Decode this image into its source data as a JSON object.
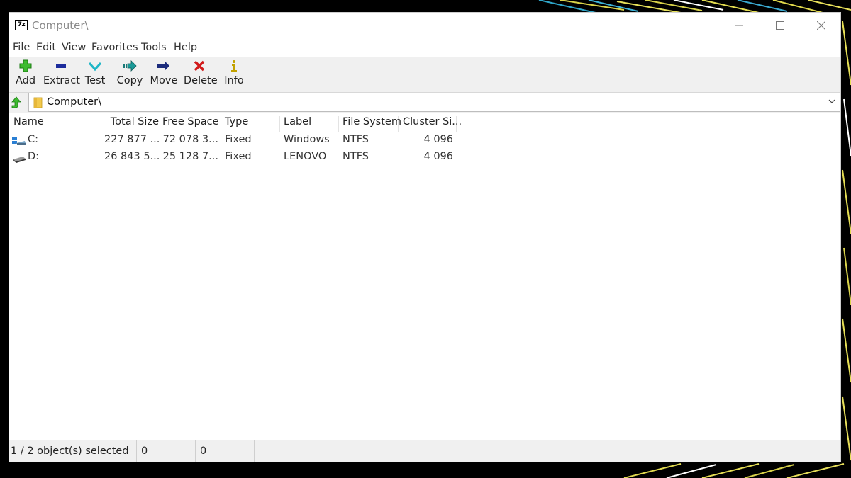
{
  "window": {
    "title": "Computer\\",
    "app_icon_text": "7z"
  },
  "menu": [
    "File",
    "Edit",
    "View",
    "Favorites",
    "Tools",
    "Help"
  ],
  "toolbar": [
    {
      "label": "Add",
      "icon": "add-icon",
      "color": "#22a822"
    },
    {
      "label": "Extract",
      "icon": "extract-icon",
      "color": "#1c2c9c"
    },
    {
      "label": "Test",
      "icon": "test-icon",
      "color": "#1fb6c7"
    },
    {
      "label": "Copy",
      "icon": "copy-icon",
      "color": "#1a7a78"
    },
    {
      "label": "Move",
      "icon": "move-icon",
      "color": "#1c2c7c"
    },
    {
      "label": "Delete",
      "icon": "delete-icon",
      "color": "#d11a1a"
    },
    {
      "label": "Info",
      "icon": "info-icon",
      "color": "#c2a200"
    }
  ],
  "address": {
    "path": "Computer\\"
  },
  "columns": [
    "Name",
    "Total Size",
    "Free Space",
    "Type",
    "Label",
    "File System",
    "Cluster Si..."
  ],
  "rows": [
    {
      "name": "C:",
      "total_size": "227 877 ...",
      "free_space": "72 078 3...",
      "type": "Fixed",
      "label": "Windows",
      "file_system": "NTFS",
      "cluster_size": "4 096",
      "icon": "system-drive-icon"
    },
    {
      "name": "D:",
      "total_size": "26 843 5...",
      "free_space": "25 128 7...",
      "type": "Fixed",
      "label": "LENOVO",
      "file_system": "NTFS",
      "cluster_size": "4 096",
      "icon": "drive-icon"
    }
  ],
  "status": {
    "selection": "1 / 2 object(s) selected",
    "size": "0",
    "packed": "0"
  }
}
